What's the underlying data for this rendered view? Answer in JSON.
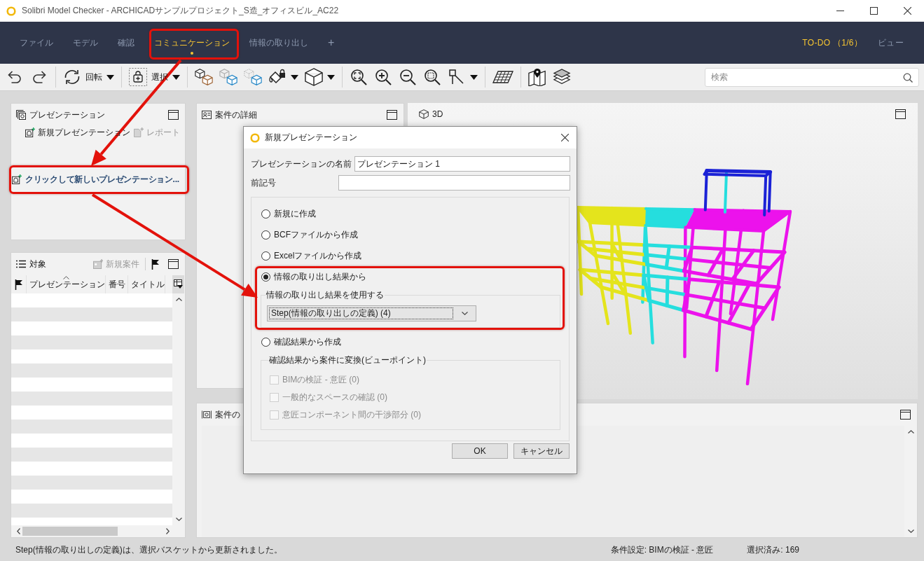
{
  "window": {
    "title": "Solibri Model Checker - ARCHICADサンプルプロジェクト_S造_オフィスビル_AC22"
  },
  "menu_bar": {
    "tabs": [
      {
        "label": "ファイル",
        "selected": false,
        "highlighted": false
      },
      {
        "label": "モデル",
        "selected": false,
        "highlighted": false
      },
      {
        "label": "確認",
        "selected": false,
        "highlighted": false
      },
      {
        "label": "コミュニケーション",
        "selected": true,
        "highlighted": true
      },
      {
        "label": "情報の取り出し",
        "selected": false,
        "highlighted": false
      }
    ],
    "add_tab": "+",
    "layouts": [
      {
        "label": "TO-DO （1/6）",
        "selected": true
      },
      {
        "label": "ビュー",
        "selected": false
      }
    ]
  },
  "toolbar": {
    "rotate": {
      "label": "回転"
    },
    "select": {
      "label": "選択"
    },
    "search": {
      "placeholder": "検索"
    }
  },
  "presentations_panel": {
    "title": "プレゼンテーション",
    "actions": [
      {
        "label": "新規プレゼンテーション",
        "disabled": false
      },
      {
        "label": "レポート",
        "disabled": true
      }
    ],
    "prompt": {
      "label": "クリックして新しいプレゼンテーション...",
      "highlighted": true
    }
  },
  "issues_panel": {
    "title": "対象",
    "action": {
      "label": "新規案件",
      "disabled": true
    },
    "columns": [
      {
        "label": "プレゼンテーション",
        "sorted": true
      },
      {
        "label": "番号",
        "sorted": false
      },
      {
        "label": "タイトル",
        "sorted": false
      }
    ]
  },
  "details_panel": {
    "title": "案件の詳細"
  },
  "view_3d": {
    "title": "3D"
  },
  "bottom_panel": {
    "title": "案件の"
  },
  "dialog": {
    "title": "新規プレゼンテーション",
    "fields": [
      {
        "label": "プレゼンテーションの名前",
        "value": "プレゼンテーション 1"
      },
      {
        "label": "前記号"
      }
    ],
    "options": [
      {
        "label": "新規に作成",
        "selected": false,
        "highlighted": false
      },
      {
        "label": "BCFファイルから作成",
        "selected": false,
        "highlighted": false
      },
      {
        "label": "Excelファイルから作成",
        "selected": false,
        "highlighted": false
      },
      {
        "label": "情報の取り出し結果から",
        "selected": true,
        "highlighted": true,
        "group": {
          "kind": "dropdown",
          "title": "情報の取り出し結果を使用する",
          "value": "Step(情報の取り出しの定義) (4)"
        }
      },
      {
        "label": "確認結果から作成",
        "selected": false,
        "highlighted": false,
        "group": {
          "kind": "checklist",
          "title": "確認結果から案件に変換(ビューポイント)",
          "items": [
            {
              "label": "BIMの検証 - 意匠 (0)",
              "checked": false,
              "disabled": true
            },
            {
              "label": "一般的なスペースの確認 (0)",
              "checked": false,
              "disabled": true
            },
            {
              "label": "意匠コンポーネント間の干渉部分 (0)",
              "checked": false,
              "disabled": true
            }
          ]
        }
      }
    ],
    "buttons": [
      {
        "label": "OK"
      },
      {
        "label": "キャンセル"
      }
    ]
  },
  "status_bar": {
    "message": "Step(情報の取り出しの定義)は、選択バスケットから更新されました。",
    "rule_set": "条件設定: BIMの検証 - 意匠",
    "selection": "選択済み: 169"
  }
}
